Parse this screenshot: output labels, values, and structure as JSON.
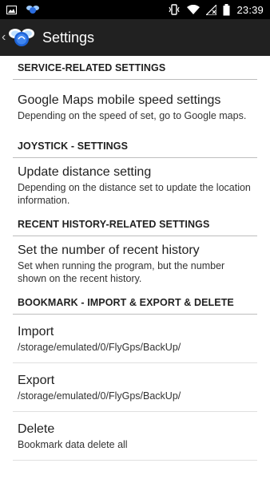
{
  "status_bar": {
    "time": "23:39",
    "left_icons": [
      "image-icon",
      "app-notification-icon"
    ],
    "right_icons": [
      "vibrate-icon",
      "wifi-icon",
      "no-signal-icon",
      "battery-icon"
    ]
  },
  "app_bar": {
    "title": "Settings",
    "back_icon": "chevron-left-icon",
    "logo_icon": "flygps-logo-icon"
  },
  "sections": [
    {
      "header": "SERVICE-RELATED SETTINGS",
      "items": [
        {
          "title": "Google Maps mobile speed settings",
          "summary": "Depending on the speed of set, go to Google maps."
        }
      ]
    },
    {
      "header": "JOYSTICK - SETTINGS",
      "items": [
        {
          "title": "Update distance setting",
          "summary": "Depending on the distance set to update the location information."
        }
      ]
    },
    {
      "header": "RECENT HISTORY-RELATED SETTINGS",
      "items": [
        {
          "title": "Set the number of recent history",
          "summary": "Set when running the program, but the number shown on the recent history."
        }
      ]
    },
    {
      "header": "BOOKMARK - IMPORT & EXPORT & DELETE",
      "items": [
        {
          "title": "Import",
          "summary": "/storage/emulated/0/FlyGps/BackUp/"
        },
        {
          "title": "Export",
          "summary": "/storage/emulated/0/FlyGps/BackUp/"
        },
        {
          "title": "Delete",
          "summary": "Bookmark data delete all"
        }
      ]
    }
  ],
  "colors": {
    "status_bar_bg": "#000000",
    "app_bar_bg": "#212121",
    "divider": "#bdbdbd",
    "background": "#ffffff"
  }
}
